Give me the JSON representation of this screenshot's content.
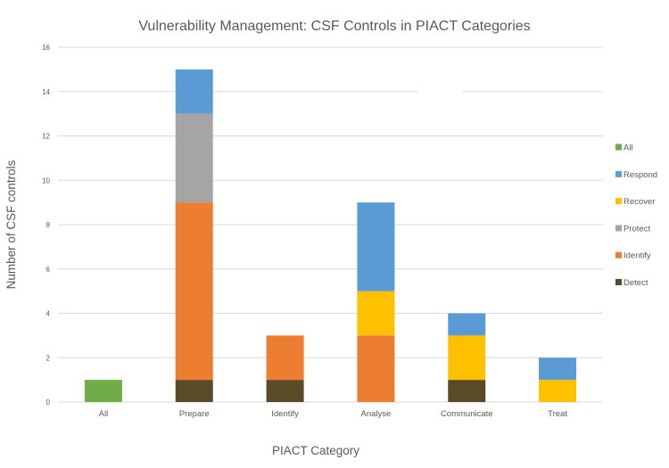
{
  "chart_data": {
    "type": "bar",
    "stacked": true,
    "title": "Vulnerability Management: CSF Controls in PIACT Categories",
    "xlabel": "PIACT Category",
    "ylabel": "Number of CSF controls",
    "ylim": [
      0,
      16
    ],
    "yticks": [
      0,
      2,
      4,
      6,
      8,
      10,
      12,
      14,
      16
    ],
    "grid": true,
    "legend_position": "right",
    "categories": [
      "All",
      "Prepare",
      "Identify",
      "Analyse",
      "Communicate",
      "Treat"
    ],
    "series": [
      {
        "name": "Detect",
        "color": "#5b4a28",
        "values": [
          0,
          1,
          1,
          0,
          1,
          0
        ]
      },
      {
        "name": "Identify",
        "color": "#ed7d31",
        "values": [
          0,
          8,
          2,
          3,
          0,
          0
        ]
      },
      {
        "name": "Protect",
        "color": "#a5a5a5",
        "values": [
          0,
          4,
          0,
          0,
          0,
          0
        ]
      },
      {
        "name": "Recover",
        "color": "#ffc000",
        "values": [
          0,
          0,
          0,
          2,
          2,
          1
        ]
      },
      {
        "name": "Respond",
        "color": "#5b9bd5",
        "values": [
          0,
          2,
          0,
          4,
          1,
          1
        ]
      },
      {
        "name": "All",
        "color": "#70ad47",
        "values": [
          1,
          0,
          0,
          0,
          0,
          0
        ]
      }
    ],
    "legend_order": [
      "All",
      "Respond",
      "Recover",
      "Protect",
      "Identify",
      "Detect"
    ]
  }
}
